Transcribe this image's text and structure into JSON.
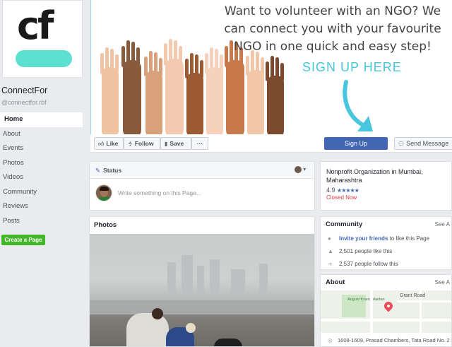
{
  "page": {
    "name": "ConnectFor",
    "handle": "@connectfor.rbf",
    "logo_text": "cf"
  },
  "nav": {
    "items": [
      "Home",
      "About",
      "Events",
      "Photos",
      "Videos",
      "Community",
      "Reviews",
      "Posts"
    ],
    "active": "Home",
    "create_page": "Create a Page"
  },
  "cover": {
    "headline_lines": [
      "Want to volunteer with an NGO? We",
      "can connect you with your favourite",
      "NGO in one quick and easy step!"
    ],
    "cta": "SIGN UP HERE",
    "accent_color": "#48c6dd"
  },
  "actions": {
    "like": "Like",
    "follow": "Follow",
    "save": "Save",
    "more": "···",
    "signup": "Sign Up",
    "message": "Send Message"
  },
  "composer": {
    "tab": "Status",
    "placeholder": "Write something on this Page..."
  },
  "photos": {
    "title": "Photos"
  },
  "info": {
    "category": "Nonprofit Organization in Mumbai, Maharashtra",
    "rating": "4.9",
    "stars": "★★★★★",
    "status": "Closed Now"
  },
  "community": {
    "title": "Community",
    "see_all": "See A",
    "invite_link": "Invite your friends",
    "invite_rest": " to like this Page",
    "likes": "2,501 people like this",
    "follows": "2,537 people follow this"
  },
  "about": {
    "title": "About",
    "see_all": "See A",
    "map_road_label": "Grant Road",
    "map_park_label": "August Kranti Maidan",
    "address": "1608-1609, Prasad Chambers, Tata Road No. 2"
  },
  "colors": {
    "brand_blue": "#4267b2",
    "green_button": "#42b72a",
    "logo_pill": "#5ce0cf"
  }
}
